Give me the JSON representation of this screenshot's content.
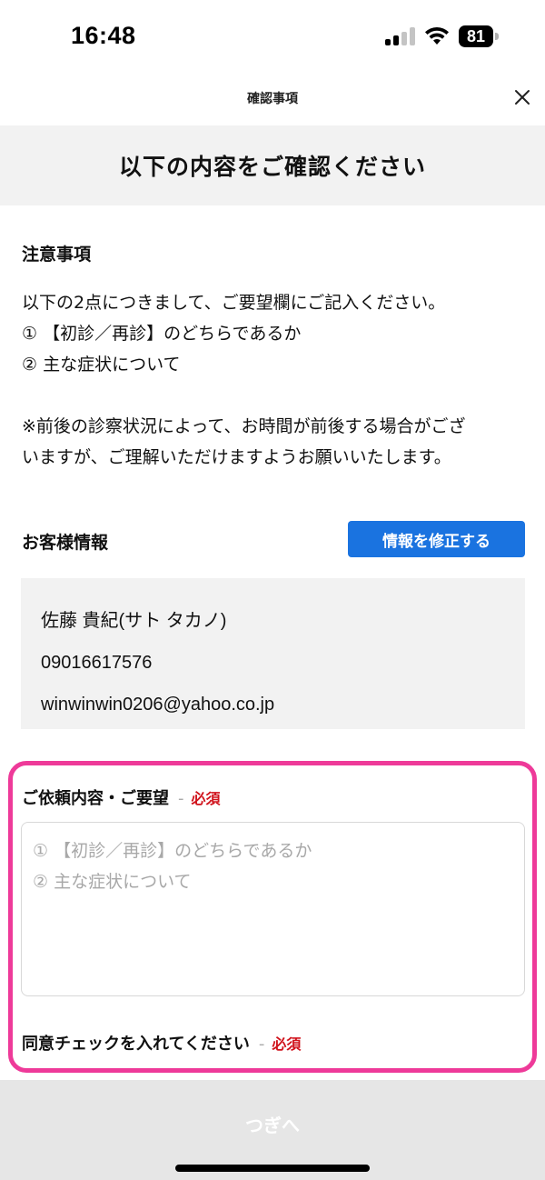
{
  "status_bar": {
    "time": "16:48",
    "battery": "81"
  },
  "header": {
    "title": "確認事項"
  },
  "banner": {
    "heading": "以下の内容をご確認ください"
  },
  "notes": {
    "title": "注意事項",
    "lines": [
      "以下の2点につきまして、ご要望欄にご記入ください。",
      "① 【初診／再診】のどちらであるか",
      "② 主な症状について",
      "※前後の診察状況によって、お時間が前後する場合がござ",
      "いますが、ご理解いただけますようお願いいたします。"
    ]
  },
  "customer": {
    "title": "お客様情報",
    "edit_label": "情報を修正する",
    "name": "佐藤 貴紀(サト タカノ)",
    "phone": "09016617576",
    "email": "winwinwin0206@yahoo.co.jp"
  },
  "request": {
    "label": "ご依頼内容・ご要望",
    "separator": "-",
    "required": "必須",
    "placeholder_lines": [
      "① 【初診／再診】のどちらであるか",
      "② 主な症状について"
    ]
  },
  "consent": {
    "label": "同意チェックを入れてください",
    "separator": "-",
    "required": "必須"
  },
  "footer": {
    "next_label": "つぎへ"
  },
  "colors": {
    "accent_blue": "#1a73e0",
    "highlight_pink": "#ee3a99",
    "required_red": "#d0121b"
  }
}
